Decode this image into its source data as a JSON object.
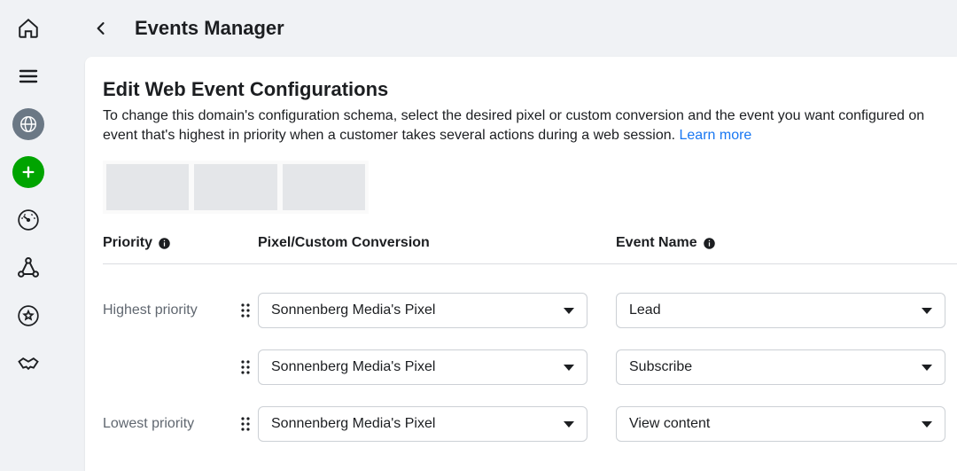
{
  "header": {
    "title": "Events Manager"
  },
  "panel": {
    "title": "Edit Web Event Configurations",
    "description_a": "To change this domain's configuration schema, select the desired pixel or custom conversion and the event you want configured on",
    "description_b": "event that's highest in priority when a customer takes several actions during a web session. ",
    "learn_more": "Learn more"
  },
  "columns": {
    "priority": "Priority",
    "pixel": "Pixel/Custom Conversion",
    "event": "Event Name"
  },
  "rows": [
    {
      "priority_label": "Highest priority",
      "pixel": "Sonnenberg Media's Pixel",
      "event": "Lead"
    },
    {
      "priority_label": "",
      "pixel": "Sonnenberg Media's Pixel",
      "event": "Subscribe"
    },
    {
      "priority_label": "Lowest priority",
      "pixel": "Sonnenberg Media's Pixel",
      "event": "View content"
    }
  ]
}
